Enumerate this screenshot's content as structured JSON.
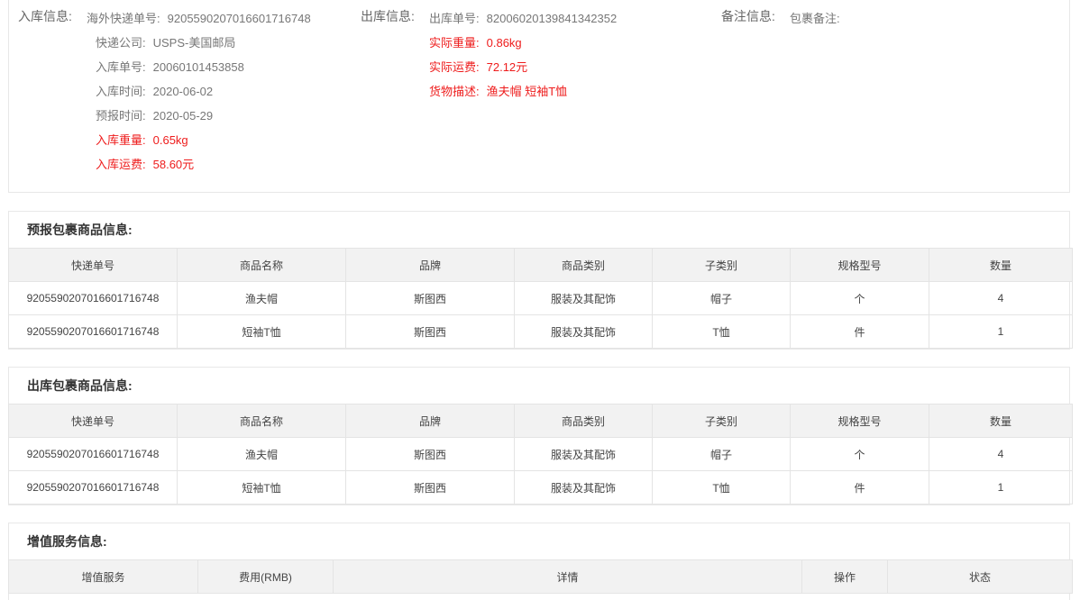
{
  "inbound": {
    "section_label": "入库信息:",
    "fields": [
      {
        "label": "海外快递单号:",
        "value": "9205590207016601716748",
        "red": false
      },
      {
        "label": "快递公司:",
        "value": "USPS-美国邮局",
        "red": false
      },
      {
        "label": "入库单号:",
        "value": "20060101453858",
        "red": false
      },
      {
        "label": "入库时间:",
        "value": "2020-06-02",
        "red": false
      },
      {
        "label": "预报时间:",
        "value": "2020-05-29",
        "red": false
      },
      {
        "label": "入库重量:",
        "value": "0.65kg",
        "red": true
      },
      {
        "label": "入库运费:",
        "value": "58.60元",
        "red": true
      }
    ]
  },
  "outbound": {
    "section_label": "出库信息:",
    "fields": [
      {
        "label": "出库单号:",
        "value": "82006020139841342352",
        "red": false
      },
      {
        "label": "实际重量:",
        "value": "0.86kg",
        "red": true
      },
      {
        "label": "实际运费:",
        "value": "72.12元",
        "red": true
      },
      {
        "label": "货物描述:",
        "value": "渔夫帽 短袖T恤",
        "red": true
      }
    ]
  },
  "remark": {
    "section_label": "备注信息:",
    "fields": [
      {
        "label": "包裹备注:",
        "value": "",
        "red": false
      }
    ]
  },
  "forecast_table": {
    "title": "预报包裹商品信息:",
    "headers": [
      "快递单号",
      "商品名称",
      "品牌",
      "商品类别",
      "子类别",
      "规格型号",
      "数量"
    ],
    "rows": [
      [
        "9205590207016601716748",
        "渔夫帽",
        "斯图西",
        "服装及其配饰",
        "帽子",
        "个",
        "4"
      ],
      [
        "9205590207016601716748",
        "短袖T恤",
        "斯图西",
        "服装及其配饰",
        "T恤",
        "件",
        "1"
      ]
    ]
  },
  "outbound_table": {
    "title": "出库包裹商品信息:",
    "headers": [
      "快递单号",
      "商品名称",
      "品牌",
      "商品类别",
      "子类别",
      "规格型号",
      "数量"
    ],
    "rows": [
      [
        "9205590207016601716748",
        "渔夫帽",
        "斯图西",
        "服装及其配饰",
        "帽子",
        "个",
        "4"
      ],
      [
        "9205590207016601716748",
        "短袖T恤",
        "斯图西",
        "服装及其配饰",
        "T恤",
        "件",
        "1"
      ]
    ]
  },
  "value_added_table": {
    "title": "增值服务信息:",
    "headers": [
      "增值服务",
      "费用(RMB)",
      "详情",
      "操作",
      "状态"
    ],
    "rows": []
  }
}
